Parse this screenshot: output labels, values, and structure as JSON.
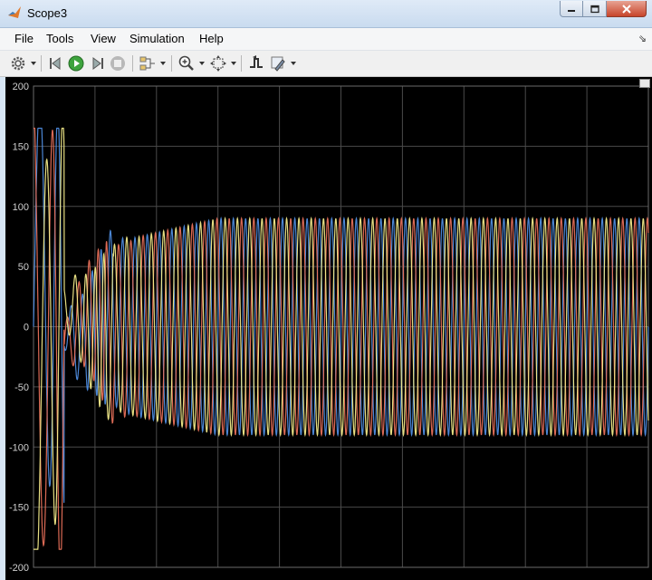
{
  "window": {
    "title": "Scope3",
    "app_icon": "matlab-logo-icon"
  },
  "menu": {
    "items": [
      "File",
      "Tools",
      "View",
      "Simulation",
      "Help"
    ]
  },
  "toolbar": {
    "icons": [
      "settings-gear-icon",
      "step-back-icon",
      "run-icon",
      "step-forward-icon",
      "stop-icon",
      "signal-selector-icon",
      "zoom-in-icon",
      "fit-to-view-icon",
      "triggers-icon",
      "highlight-icon"
    ]
  },
  "colors": {
    "plot_background": "#000000",
    "grid": "#4a4a4a",
    "axis_labels": "#cfcfcf",
    "series_blue": "#4f8de0",
    "series_orange": "#e8705a",
    "series_yellow": "#f3eb8a"
  },
  "chart_data": {
    "type": "line",
    "ylim": [
      -200,
      200
    ],
    "yticks": [
      200,
      150,
      100,
      50,
      0,
      -50,
      -100,
      -150,
      -200
    ],
    "grid": true,
    "x_tick_count": 10,
    "series": [
      {
        "color": "#4f8de0",
        "phase_deg": 0,
        "steady_amplitude": 90
      },
      {
        "color": "#e8705a",
        "phase_deg": 120,
        "steady_amplitude": 90
      },
      {
        "color": "#f3eb8a",
        "phase_deg": 240,
        "steady_amplitude": 90
      }
    ],
    "transient": {
      "peak_max": 165,
      "peak_min": -185,
      "steady_offset": 0,
      "cycles_visible": 50
    }
  }
}
